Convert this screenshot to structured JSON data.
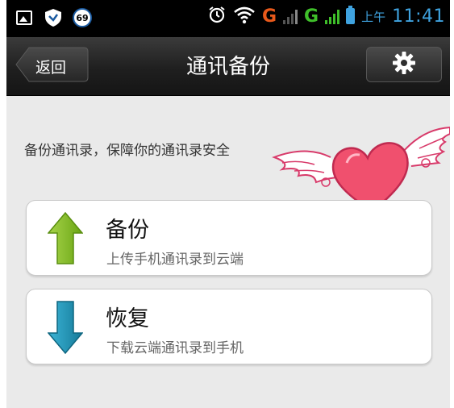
{
  "status_bar": {
    "badge_count": "69",
    "network_1": "G",
    "network_2": "G",
    "ampm": "上午",
    "time": "11:41",
    "icons": [
      "image-icon",
      "shield-icon",
      "alarm-icon",
      "wifi-icon",
      "signal-icon",
      "battery-icon"
    ]
  },
  "titlebar": {
    "back_label": "返回",
    "title": "通讯备份",
    "settings_icon": "gear-icon"
  },
  "main": {
    "description": "备份通讯录，保障你的通讯录安全",
    "decoration": "winged-heart",
    "options": [
      {
        "title": "备份",
        "subtitle": "上传手机通讯录到云端",
        "icon": "arrow-up-icon",
        "color": "#7ab51d"
      },
      {
        "title": "恢复",
        "subtitle": "下载云端通讯录到手机",
        "icon": "arrow-down-icon",
        "color": "#1c8fb0"
      }
    ]
  },
  "colors": {
    "titlebar": "#1f1f1f",
    "background": "#eaeaea",
    "status_accent": "#3fa3e0",
    "network_orange": "#e8591b",
    "network_green": "#3fbf2a",
    "heart": "#f0506e"
  }
}
